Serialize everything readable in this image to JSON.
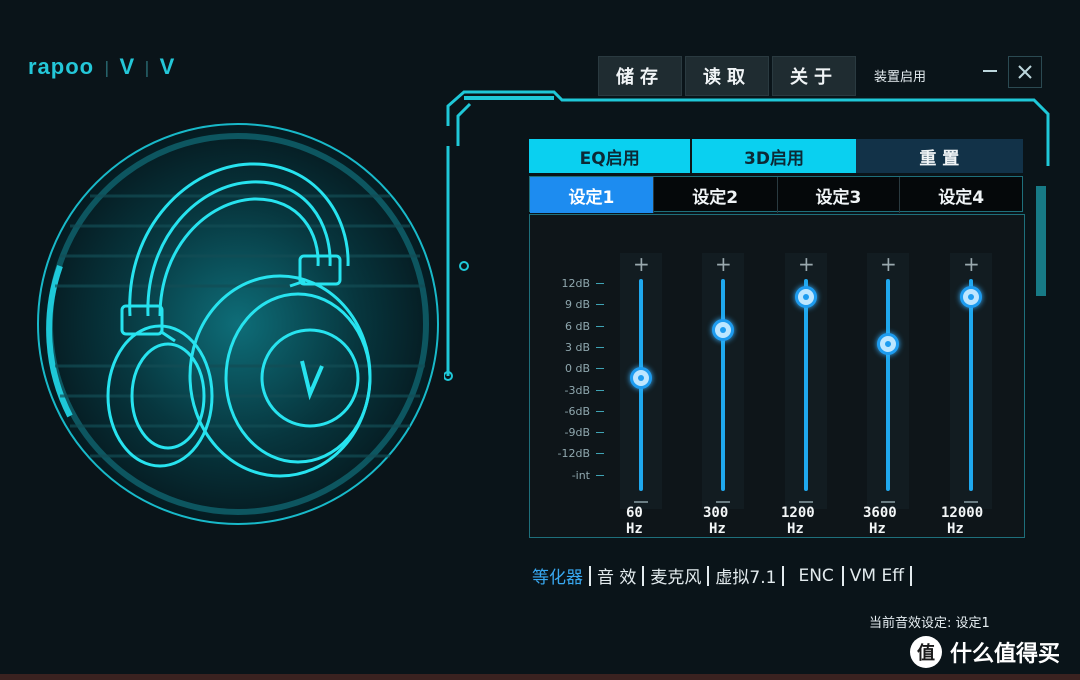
{
  "brand": {
    "name": "rapoo",
    "mark1": "V",
    "mark2": "V"
  },
  "toolbar": {
    "save": "储存",
    "load": "读取",
    "about": "关于"
  },
  "device": {
    "label": "装置启用"
  },
  "window": {
    "minimize_icon": "minimize-icon",
    "close_icon": "close-icon"
  },
  "tabs": {
    "eq": "EQ启用",
    "d3": "3D启用",
    "reset": "重 置"
  },
  "presets": [
    "设定1",
    "设定2",
    "设定3",
    "设定4"
  ],
  "eq": {
    "db_labels": [
      "12dB",
      "9 dB",
      "6 dB",
      "3 dB",
      "0 dB",
      "-3dB",
      "-6dB",
      "-9dB",
      "-12dB",
      "-int"
    ],
    "bands": [
      {
        "freq": "60",
        "unit": "Hz",
        "gain_db": -0.1
      },
      {
        "freq": "300",
        "unit": "Hz",
        "gain_db": 7.0
      },
      {
        "freq": "1200",
        "unit": "Hz",
        "gain_db": 12.0
      },
      {
        "freq": "3600",
        "unit": "Hz",
        "gain_db": 5.0
      },
      {
        "freq": "12000",
        "unit": "Hz",
        "gain_db": 12.0
      }
    ]
  },
  "menu": [
    "等化器",
    "音 效",
    "麦克风",
    "虚拟7.1",
    "ENC",
    "VM Eff"
  ],
  "status": {
    "current": "当前音效设定: 设定1"
  },
  "watermark": {
    "text": "什么值得买",
    "logo": "值"
  },
  "colors": {
    "accent": "#1fc8d8",
    "blue": "#1d9cf0",
    "tab_active": "#0ad0f0"
  }
}
